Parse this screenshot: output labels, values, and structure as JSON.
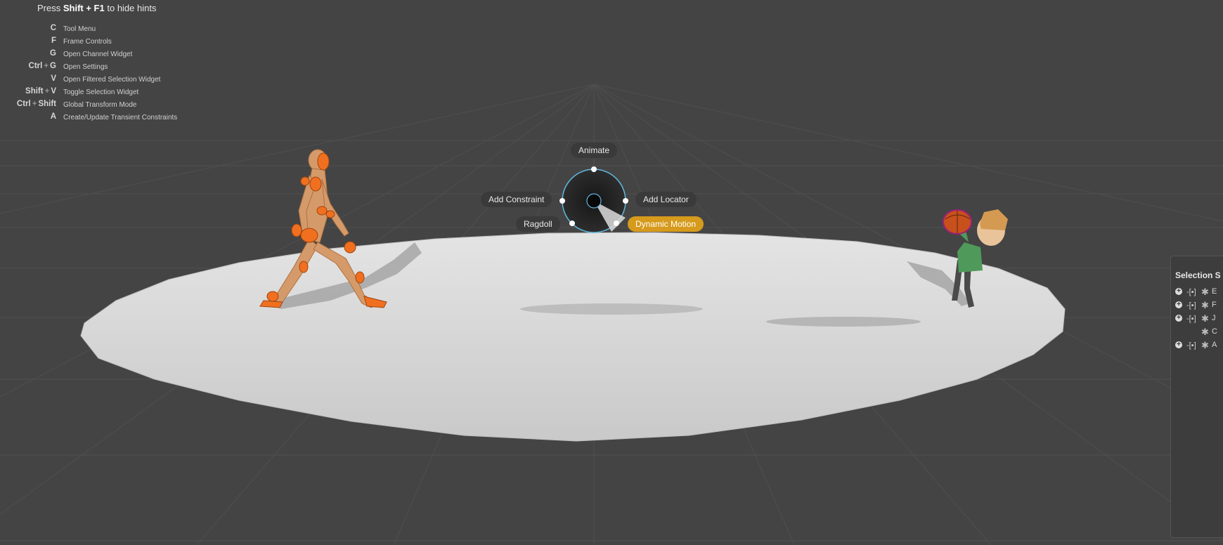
{
  "hints": {
    "header_prefix": "Press",
    "header_keys": "Shift + F1",
    "header_suffix": "to hide hints",
    "rows": [
      {
        "key": "C",
        "label": "Tool Menu"
      },
      {
        "key": "F",
        "label": "Frame Controls"
      },
      {
        "key": "G",
        "label": "Open Channel Widget"
      },
      {
        "key_a": "Ctrl",
        "key_b": "G",
        "label": "Open Settings"
      },
      {
        "key": "V",
        "label": "Open Filtered Selection Widget"
      },
      {
        "key_a": "Shift",
        "key_b": "V",
        "label": "Toggle Selection Widget"
      },
      {
        "key_a": "Ctrl",
        "key_b": "Shift",
        "label": "Global Transform Mode"
      },
      {
        "key": "A",
        "label": "Create/Update Transient Constraints"
      }
    ]
  },
  "radial_menu": {
    "top": "Animate",
    "left": "Add Constraint",
    "right": "Add Locator",
    "bottom_left": "Ragdoll",
    "bottom_right": "Dynamic Motion",
    "active_item": "Dynamic Motion",
    "accent_color": "#d69a1c",
    "ring_color": "#5fb8e0"
  },
  "selection_panel": {
    "title": "Selection S",
    "rows": [
      {
        "name": "E"
      },
      {
        "name": "F"
      },
      {
        "name": "J"
      },
      {
        "name": "C"
      },
      {
        "name": "A"
      }
    ]
  },
  "scene": {
    "background_color": "#444444",
    "ground_color": "#d2d2d2",
    "figure_left_color": "#f07020",
    "figure_right_shirt_color": "#4f9a5a",
    "ball_color": "#c8501c"
  }
}
